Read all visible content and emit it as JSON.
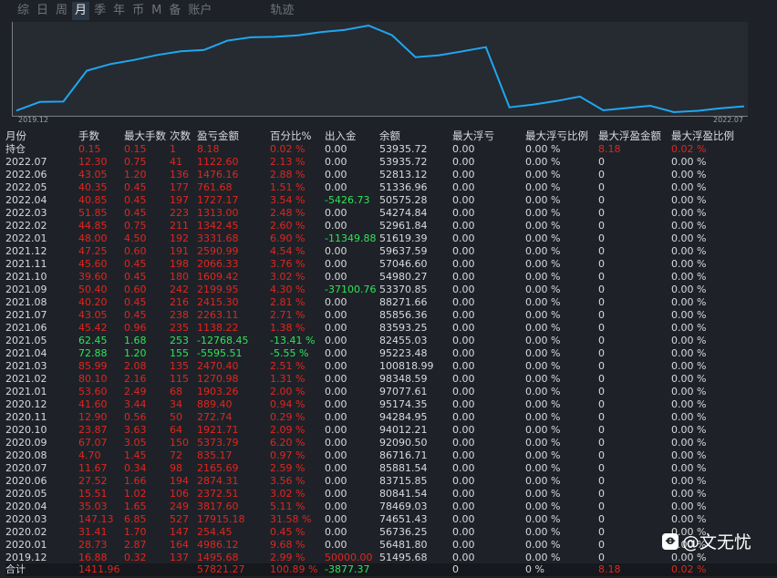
{
  "tabs": [
    {
      "label": "综",
      "active": false
    },
    {
      "label": "日",
      "active": false
    },
    {
      "label": "周",
      "active": false
    },
    {
      "label": "月",
      "active": true
    },
    {
      "label": "季",
      "active": false
    },
    {
      "label": "年",
      "active": false
    },
    {
      "label": "币",
      "active": false
    },
    {
      "label": "M",
      "active": false
    },
    {
      "label": "备",
      "active": false
    },
    {
      "label": "账户",
      "active": false
    },
    {
      "label": "轨迹",
      "active": false
    }
  ],
  "chart_data": {
    "type": "line",
    "x_start": "2019.12",
    "x_end": "2022.07",
    "line_color": "#1fa7f0",
    "x": [
      "2019.12",
      "2020.01",
      "2020.02",
      "2020.03",
      "2020.04",
      "2020.05",
      "2020.06",
      "2020.07",
      "2020.08",
      "2020.09",
      "2020.10",
      "2020.11",
      "2020.12",
      "2021.01",
      "2021.02",
      "2021.03",
      "2021.04",
      "2021.05",
      "2021.06",
      "2021.07",
      "2021.08",
      "2021.09",
      "2021.10",
      "2021.11",
      "2021.12",
      "2022.01",
      "2022.02",
      "2022.03",
      "2022.04",
      "2022.05",
      "2022.06",
      "2022.07"
    ],
    "values": [
      51495.68,
      56481.8,
      56736.25,
      74651.43,
      78469.03,
      80841.54,
      83715.85,
      85881.54,
      86716.71,
      92090.5,
      94012.21,
      94284.95,
      95174.35,
      97077.61,
      98348.59,
      100818.99,
      95223.48,
      82455.03,
      83593.25,
      85856.36,
      88271.66,
      53370.85,
      54980.27,
      57046.6,
      59637.59,
      51619.39,
      52961.84,
      54274.84,
      50575.28,
      51336.96,
      52813.12,
      53935.72
    ]
  },
  "columns": [
    "月份",
    "手数",
    "最大手数",
    "次数",
    "盈亏金额",
    "百分比%",
    "出入金",
    "余额",
    "最大浮亏",
    "最大浮亏比例",
    "最大浮盈金额",
    "最大浮盈比例"
  ],
  "rows": [
    {
      "m": "持仓",
      "lots": "0.15",
      "maxlots": "0.15",
      "cnt": "1",
      "pnl": "8.18",
      "pct": "0.02 %",
      "flow": "0.00",
      "bal": "53935.72",
      "mdd": "0.00",
      "mddp": "0.00 %",
      "mfe": "8.18",
      "mfep": "0.02 %",
      "c": "r",
      "flowc": "w",
      "mfec": "r"
    },
    {
      "m": "2022.07",
      "lots": "12.30",
      "maxlots": "0.75",
      "cnt": "41",
      "pnl": "1122.60",
      "pct": "2.13 %",
      "flow": "0.00",
      "bal": "53935.72",
      "mdd": "0.00",
      "mddp": "0.00 %",
      "mfe": "0",
      "mfep": "0.00 %",
      "c": "r",
      "flowc": "w",
      "mfec": "w"
    },
    {
      "m": "2022.06",
      "lots": "43.05",
      "maxlots": "1.20",
      "cnt": "136",
      "pnl": "1476.16",
      "pct": "2.88 %",
      "flow": "0.00",
      "bal": "52813.12",
      "mdd": "0.00",
      "mddp": "0.00 %",
      "mfe": "0",
      "mfep": "0.00 %",
      "c": "r",
      "flowc": "w",
      "mfec": "w"
    },
    {
      "m": "2022.05",
      "lots": "40.35",
      "maxlots": "0.45",
      "cnt": "177",
      "pnl": "761.68",
      "pct": "1.51 %",
      "flow": "0.00",
      "bal": "51336.96",
      "mdd": "0.00",
      "mddp": "0.00 %",
      "mfe": "0",
      "mfep": "0.00 %",
      "c": "r",
      "flowc": "w",
      "mfec": "w"
    },
    {
      "m": "2022.04",
      "lots": "40.85",
      "maxlots": "0.45",
      "cnt": "197",
      "pnl": "1727.17",
      "pct": "3.54 %",
      "flow": "-5426.73",
      "bal": "50575.28",
      "mdd": "0.00",
      "mddp": "0.00 %",
      "mfe": "0",
      "mfep": "0.00 %",
      "c": "r",
      "flowc": "g",
      "mfec": "w"
    },
    {
      "m": "2022.03",
      "lots": "51.85",
      "maxlots": "0.45",
      "cnt": "223",
      "pnl": "1313.00",
      "pct": "2.48 %",
      "flow": "0.00",
      "bal": "54274.84",
      "mdd": "0.00",
      "mddp": "0.00 %",
      "mfe": "0",
      "mfep": "0.00 %",
      "c": "r",
      "flowc": "w",
      "mfec": "w"
    },
    {
      "m": "2022.02",
      "lots": "44.85",
      "maxlots": "0.75",
      "cnt": "211",
      "pnl": "1342.45",
      "pct": "2.60 %",
      "flow": "0.00",
      "bal": "52961.84",
      "mdd": "0.00",
      "mddp": "0.00 %",
      "mfe": "0",
      "mfep": "0.00 %",
      "c": "r",
      "flowc": "w",
      "mfec": "w"
    },
    {
      "m": "2022.01",
      "lots": "48.00",
      "maxlots": "4.50",
      "cnt": "192",
      "pnl": "3331.68",
      "pct": "6.90 %",
      "flow": "-11349.88",
      "bal": "51619.39",
      "mdd": "0.00",
      "mddp": "0.00 %",
      "mfe": "0",
      "mfep": "0.00 %",
      "c": "r",
      "flowc": "g",
      "mfec": "w"
    },
    {
      "m": "2021.12",
      "lots": "47.25",
      "maxlots": "0.60",
      "cnt": "191",
      "pnl": "2590.99",
      "pct": "4.54 %",
      "flow": "0.00",
      "bal": "59637.59",
      "mdd": "0.00",
      "mddp": "0.00 %",
      "mfe": "0",
      "mfep": "0.00 %",
      "c": "r",
      "flowc": "w",
      "mfec": "w"
    },
    {
      "m": "2021.11",
      "lots": "45.60",
      "maxlots": "0.45",
      "cnt": "198",
      "pnl": "2066.33",
      "pct": "3.76 %",
      "flow": "0.00",
      "bal": "57046.60",
      "mdd": "0.00",
      "mddp": "0.00 %",
      "mfe": "0",
      "mfep": "0.00 %",
      "c": "r",
      "flowc": "w",
      "mfec": "w"
    },
    {
      "m": "2021.10",
      "lots": "39.60",
      "maxlots": "0.45",
      "cnt": "180",
      "pnl": "1609.42",
      "pct": "3.02 %",
      "flow": "0.00",
      "bal": "54980.27",
      "mdd": "0.00",
      "mddp": "0.00 %",
      "mfe": "0",
      "mfep": "0.00 %",
      "c": "r",
      "flowc": "w",
      "mfec": "w"
    },
    {
      "m": "2021.09",
      "lots": "50.40",
      "maxlots": "0.60",
      "cnt": "242",
      "pnl": "2199.95",
      "pct": "4.30 %",
      "flow": "-37100.76",
      "bal": "53370.85",
      "mdd": "0.00",
      "mddp": "0.00 %",
      "mfe": "0",
      "mfep": "0.00 %",
      "c": "r",
      "flowc": "g",
      "mfec": "w"
    },
    {
      "m": "2021.08",
      "lots": "40.20",
      "maxlots": "0.45",
      "cnt": "216",
      "pnl": "2415.30",
      "pct": "2.81 %",
      "flow": "0.00",
      "bal": "88271.66",
      "mdd": "0.00",
      "mddp": "0.00 %",
      "mfe": "0",
      "mfep": "0.00 %",
      "c": "r",
      "flowc": "w",
      "mfec": "w"
    },
    {
      "m": "2021.07",
      "lots": "43.05",
      "maxlots": "0.45",
      "cnt": "238",
      "pnl": "2263.11",
      "pct": "2.71 %",
      "flow": "0.00",
      "bal": "85856.36",
      "mdd": "0.00",
      "mddp": "0.00 %",
      "mfe": "0",
      "mfep": "0.00 %",
      "c": "r",
      "flowc": "w",
      "mfec": "w"
    },
    {
      "m": "2021.06",
      "lots": "45.42",
      "maxlots": "0.96",
      "cnt": "235",
      "pnl": "1138.22",
      "pct": "1.38 %",
      "flow": "0.00",
      "bal": "83593.25",
      "mdd": "0.00",
      "mddp": "0.00 %",
      "mfe": "0",
      "mfep": "0.00 %",
      "c": "r",
      "flowc": "w",
      "mfec": "w"
    },
    {
      "m": "2021.05",
      "lots": "62.45",
      "maxlots": "1.68",
      "cnt": "253",
      "pnl": "-12768.45",
      "pct": "-13.41 %",
      "flow": "0.00",
      "bal": "82455.03",
      "mdd": "0.00",
      "mddp": "0.00 %",
      "mfe": "0",
      "mfep": "0.00 %",
      "c": "g",
      "flowc": "w",
      "mfec": "w"
    },
    {
      "m": "2021.04",
      "lots": "72.88",
      "maxlots": "1.20",
      "cnt": "155",
      "pnl": "-5595.51",
      "pct": "-5.55 %",
      "flow": "0.00",
      "bal": "95223.48",
      "mdd": "0.00",
      "mddp": "0.00 %",
      "mfe": "0",
      "mfep": "0.00 %",
      "c": "g",
      "flowc": "w",
      "mfec": "w"
    },
    {
      "m": "2021.03",
      "lots": "85.99",
      "maxlots": "2.08",
      "cnt": "135",
      "pnl": "2470.40",
      "pct": "2.51 %",
      "flow": "0.00",
      "bal": "100818.99",
      "mdd": "0.00",
      "mddp": "0.00 %",
      "mfe": "0",
      "mfep": "0.00 %",
      "c": "r",
      "flowc": "w",
      "mfec": "w"
    },
    {
      "m": "2021.02",
      "lots": "80.10",
      "maxlots": "2.16",
      "cnt": "115",
      "pnl": "1270.98",
      "pct": "1.31 %",
      "flow": "0.00",
      "bal": "98348.59",
      "mdd": "0.00",
      "mddp": "0.00 %",
      "mfe": "0",
      "mfep": "0.00 %",
      "c": "r",
      "flowc": "w",
      "mfec": "w"
    },
    {
      "m": "2021.01",
      "lots": "53.60",
      "maxlots": "2.49",
      "cnt": "68",
      "pnl": "1903.26",
      "pct": "2.00 %",
      "flow": "0.00",
      "bal": "97077.61",
      "mdd": "0.00",
      "mddp": "0.00 %",
      "mfe": "0",
      "mfep": "0.00 %",
      "c": "r",
      "flowc": "w",
      "mfec": "w"
    },
    {
      "m": "2020.12",
      "lots": "41.60",
      "maxlots": "3.44",
      "cnt": "34",
      "pnl": "889.40",
      "pct": "0.94 %",
      "flow": "0.00",
      "bal": "95174.35",
      "mdd": "0.00",
      "mddp": "0.00 %",
      "mfe": "0",
      "mfep": "0.00 %",
      "c": "r",
      "flowc": "w",
      "mfec": "w"
    },
    {
      "m": "2020.11",
      "lots": "12.90",
      "maxlots": "0.56",
      "cnt": "50",
      "pnl": "272.74",
      "pct": "0.29 %",
      "flow": "0.00",
      "bal": "94284.95",
      "mdd": "0.00",
      "mddp": "0.00 %",
      "mfe": "0",
      "mfep": "0.00 %",
      "c": "r",
      "flowc": "w",
      "mfec": "w"
    },
    {
      "m": "2020.10",
      "lots": "23.87",
      "maxlots": "3.63",
      "cnt": "64",
      "pnl": "1921.71",
      "pct": "2.09 %",
      "flow": "0.00",
      "bal": "94012.21",
      "mdd": "0.00",
      "mddp": "0.00 %",
      "mfe": "0",
      "mfep": "0.00 %",
      "c": "r",
      "flowc": "w",
      "mfec": "w"
    },
    {
      "m": "2020.09",
      "lots": "67.07",
      "maxlots": "3.05",
      "cnt": "150",
      "pnl": "5373.79",
      "pct": "6.20 %",
      "flow": "0.00",
      "bal": "92090.50",
      "mdd": "0.00",
      "mddp": "0.00 %",
      "mfe": "0",
      "mfep": "0.00 %",
      "c": "r",
      "flowc": "w",
      "mfec": "w"
    },
    {
      "m": "2020.08",
      "lots": "4.70",
      "maxlots": "1.45",
      "cnt": "72",
      "pnl": "835.17",
      "pct": "0.97 %",
      "flow": "0.00",
      "bal": "86716.71",
      "mdd": "0.00",
      "mddp": "0.00 %",
      "mfe": "0",
      "mfep": "0.00 %",
      "c": "r",
      "flowc": "w",
      "mfec": "w"
    },
    {
      "m": "2020.07",
      "lots": "11.67",
      "maxlots": "0.34",
      "cnt": "98",
      "pnl": "2165.69",
      "pct": "2.59 %",
      "flow": "0.00",
      "bal": "85881.54",
      "mdd": "0.00",
      "mddp": "0.00 %",
      "mfe": "0",
      "mfep": "0.00 %",
      "c": "r",
      "flowc": "w",
      "mfec": "w"
    },
    {
      "m": "2020.06",
      "lots": "27.52",
      "maxlots": "1.66",
      "cnt": "194",
      "pnl": "2874.31",
      "pct": "3.56 %",
      "flow": "0.00",
      "bal": "83715.85",
      "mdd": "0.00",
      "mddp": "0.00 %",
      "mfe": "0",
      "mfep": "0.00 %",
      "c": "r",
      "flowc": "w",
      "mfec": "w"
    },
    {
      "m": "2020.05",
      "lots": "15.51",
      "maxlots": "1.02",
      "cnt": "106",
      "pnl": "2372.51",
      "pct": "3.02 %",
      "flow": "0.00",
      "bal": "80841.54",
      "mdd": "0.00",
      "mddp": "0.00 %",
      "mfe": "0",
      "mfep": "0.00 %",
      "c": "r",
      "flowc": "w",
      "mfec": "w"
    },
    {
      "m": "2020.04",
      "lots": "35.03",
      "maxlots": "1.65",
      "cnt": "249",
      "pnl": "3817.60",
      "pct": "5.11 %",
      "flow": "0.00",
      "bal": "78469.03",
      "mdd": "0.00",
      "mddp": "0.00 %",
      "mfe": "0",
      "mfep": "0.00 %",
      "c": "r",
      "flowc": "w",
      "mfec": "w"
    },
    {
      "m": "2020.03",
      "lots": "147.13",
      "maxlots": "6.85",
      "cnt": "527",
      "pnl": "17915.18",
      "pct": "31.58 %",
      "flow": "0.00",
      "bal": "74651.43",
      "mdd": "0.00",
      "mddp": "0.00 %",
      "mfe": "0",
      "mfep": "0.00 %",
      "c": "r",
      "flowc": "w",
      "mfec": "w"
    },
    {
      "m": "2020.02",
      "lots": "31.41",
      "maxlots": "1.70",
      "cnt": "147",
      "pnl": "254.45",
      "pct": "0.45 %",
      "flow": "0.00",
      "bal": "56736.25",
      "mdd": "0.00",
      "mddp": "0.00 %",
      "mfe": "0",
      "mfep": "0.00 %",
      "c": "r",
      "flowc": "w",
      "mfec": "w"
    },
    {
      "m": "2020.01",
      "lots": "28.73",
      "maxlots": "2.87",
      "cnt": "164",
      "pnl": "4986.12",
      "pct": "9.68 %",
      "flow": "0.00",
      "bal": "56481.80",
      "mdd": "0.00",
      "mddp": "0.00 %",
      "mfe": "0",
      "mfep": "0.00 %",
      "c": "r",
      "flowc": "w",
      "mfec": "w"
    },
    {
      "m": "2019.12",
      "lots": "16.88",
      "maxlots": "0.32",
      "cnt": "137",
      "pnl": "1495.68",
      "pct": "2.99 %",
      "flow": "50000.00",
      "bal": "51495.68",
      "mdd": "0.00",
      "mddp": "0.00 %",
      "mfe": "0",
      "mfep": "0.00 %",
      "c": "r",
      "flowc": "r",
      "mfec": "w"
    }
  ],
  "total": {
    "m": "合计",
    "lots": "1411.96",
    "maxlots": "",
    "cnt": "",
    "pnl": "57821.27",
    "pct": "100.89 %",
    "flow": "-3877.37",
    "bal": "",
    "mdd": "0",
    "mddp": "0 %",
    "mfe": "8.18",
    "mfep": "0.02 %"
  },
  "watermark": {
    "text": "@文无忧"
  }
}
